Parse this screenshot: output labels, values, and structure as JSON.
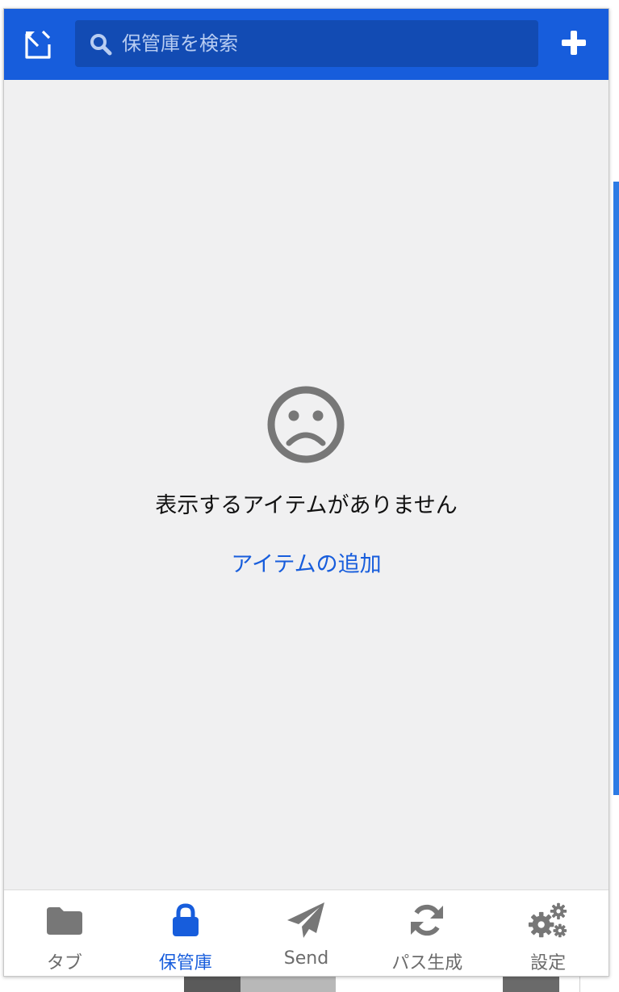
{
  "colors": {
    "brand": "#175ddc",
    "search_bg": "#124bb3",
    "content_bg": "#f0f0f1",
    "icon_muted": "#777777",
    "link": "#175ddc"
  },
  "header": {
    "popout_icon": "popout-icon",
    "search": {
      "placeholder": "保管庫を検索",
      "value": "",
      "icon": "search-icon"
    },
    "add_icon": "plus-icon"
  },
  "empty_state": {
    "icon": "frown-icon",
    "message": "表示するアイテムがありません",
    "add_link": "アイテムの追加"
  },
  "tabs": [
    {
      "label": "タブ",
      "icon": "folder-icon",
      "active": false
    },
    {
      "label": "保管庫",
      "icon": "lock-icon",
      "active": true
    },
    {
      "label": "Send",
      "icon": "paper-plane-icon",
      "active": false
    },
    {
      "label": "パス生成",
      "icon": "refresh-icon",
      "active": false
    },
    {
      "label": "設定",
      "icon": "gears-icon",
      "active": false
    }
  ]
}
